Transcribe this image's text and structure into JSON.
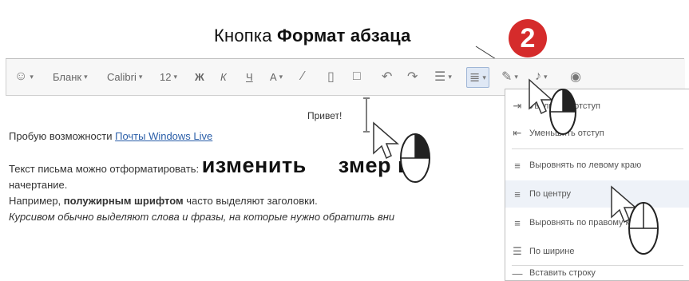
{
  "callout": {
    "prefix": "Кнопка ",
    "bold": "Формат абзаца",
    "step": "2"
  },
  "toolbar": {
    "emoticon_caret": "▾",
    "stationery": "Бланк",
    "font": "Calibri",
    "size": "12",
    "strike_label": "Ж",
    "italic_label": "К",
    "underline_label": "Ч",
    "color_label": "А"
  },
  "body": {
    "greeting": "Привет!",
    "line1_prefix": "Пробую возможности ",
    "line1_link": "Почты Windows Live",
    "line2_prefix": "Текст письма можно отформатировать: ",
    "line2_big": "изменить",
    "line2_big_tail": "змер ш",
    "line3": "начертание.",
    "line4_prefix": "Например, ",
    "line4_bold": "полужирным шрифтом",
    "line4_suffix": " часто выделяют заголовки.",
    "line5": "Курсивом обычно выделяют слова и фразы, на которые нужно обратить вни"
  },
  "menu": {
    "items": [
      {
        "icon": "increase-indent-icon",
        "label": "Увеличить отступ"
      },
      {
        "icon": "decrease-indent-icon",
        "label": "Уменьшить отступ"
      },
      {
        "icon": "align-left-icon",
        "label": "Выровнять по левому краю"
      },
      {
        "icon": "align-center-icon",
        "label": "По центру"
      },
      {
        "icon": "align-right-icon",
        "label": "Выровнять по правому краю"
      },
      {
        "icon": "justify-icon",
        "label": "По ширине"
      },
      {
        "icon": "insert-line-icon",
        "label": "Вставить строку"
      }
    ]
  },
  "colors": {
    "badge": "#d52b2b",
    "link": "#2a5ea8",
    "menu_selected": "#eef2f8"
  }
}
